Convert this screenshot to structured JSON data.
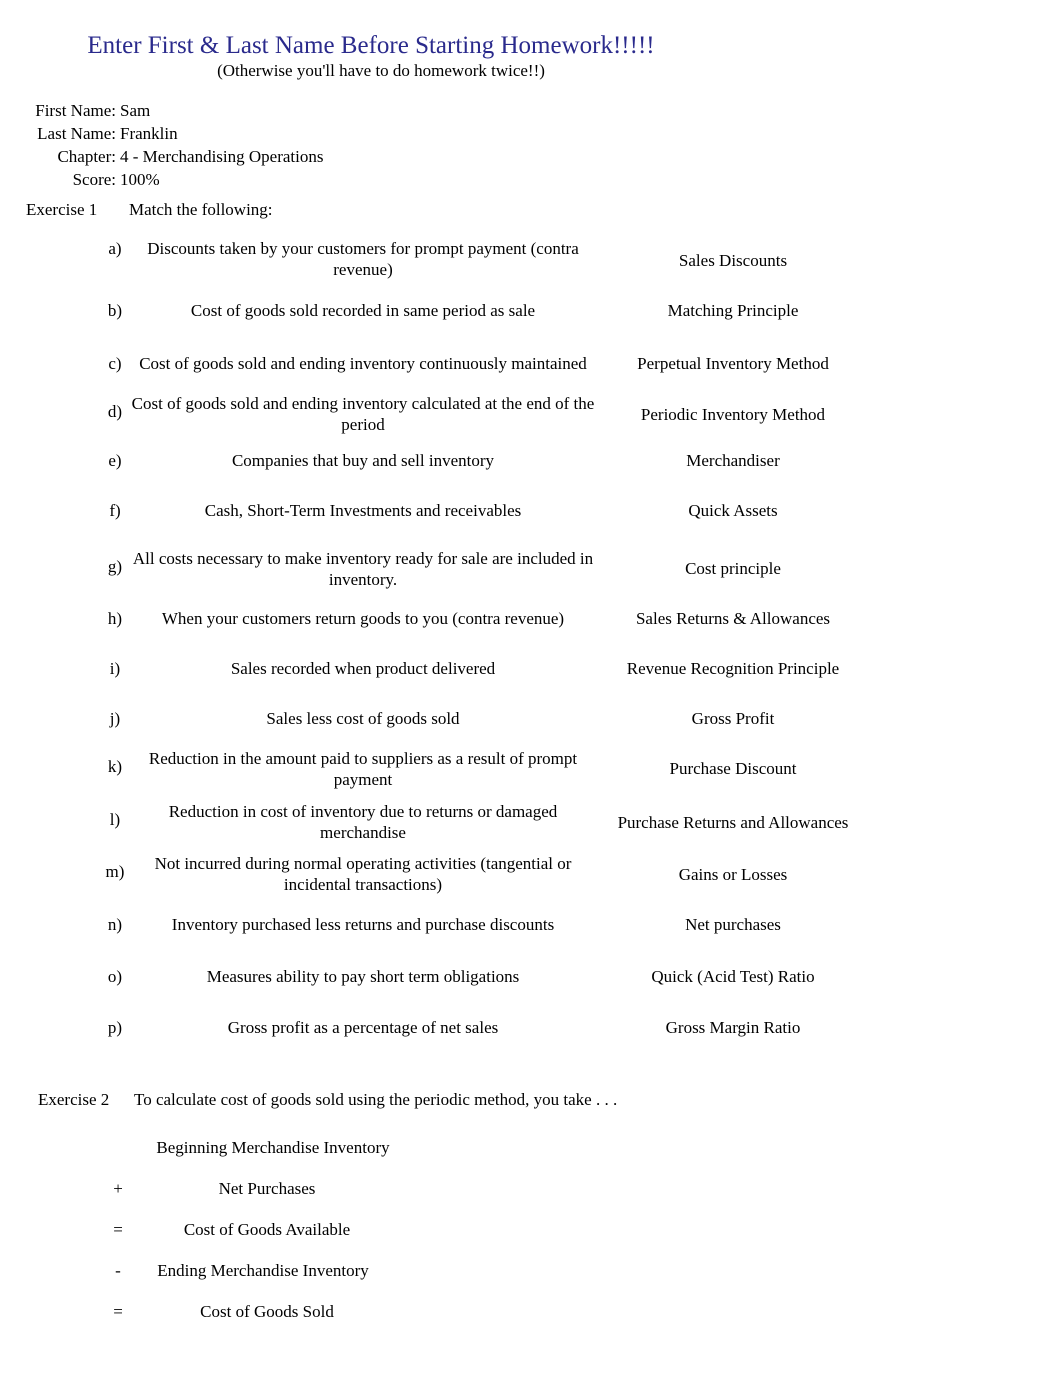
{
  "header": {
    "title": "Enter First & Last Name Before Starting Homework!!!!!",
    "subtitle": "(Otherwise you'll have to do homework twice!!)",
    "title_color": "#2a2a8c"
  },
  "info": {
    "fields": [
      {
        "label": "First Name:",
        "value": "Sam"
      },
      {
        "label": "Last Name:",
        "value": "Franklin"
      },
      {
        "label": "Chapter:",
        "value": "4 - Merchandising Operations"
      },
      {
        "label": "Score:",
        "value": "100%"
      }
    ]
  },
  "exercise1": {
    "number": "Exercise 1",
    "instruction": "Match the following:",
    "rows": [
      {
        "letter": "a)",
        "description": "Discounts taken by your customers for prompt payment (contra revenue)",
        "term": "Sales Discounts"
      },
      {
        "letter": "b)",
        "description": "Cost of goods sold recorded in same period as sale",
        "term": "Matching Principle"
      },
      {
        "letter": "c)",
        "description": "Cost of goods sold and ending inventory continuously maintained",
        "term": "Perpetual Inventory Method"
      },
      {
        "letter": "d)",
        "description": "Cost of goods sold and ending inventory calculated at the end of the period",
        "term": "Periodic Inventory Method"
      },
      {
        "letter": "e)",
        "description": "Companies that buy and sell inventory",
        "term": "Merchandiser"
      },
      {
        "letter": "f)",
        "description": "Cash, Short-Term Investments and receivables",
        "term": "Quick Assets"
      },
      {
        "letter": "g)",
        "description": "All costs necessary to make inventory ready for sale are included in inventory.",
        "term": "Cost principle"
      },
      {
        "letter": "h)",
        "description": "When your customers return goods to you (contra revenue)",
        "term": "Sales Returns & Allowances"
      },
      {
        "letter": "i)",
        "description": "Sales recorded when product delivered",
        "term": "Revenue Recognition Principle"
      },
      {
        "letter": "j)",
        "description": "Sales less cost of goods sold",
        "term": "Gross Profit"
      },
      {
        "letter": "k)",
        "description": "Reduction in the amount paid to suppliers as a result of prompt payment",
        "term": "Purchase Discount"
      },
      {
        "letter": "l)",
        "description": "Reduction in cost of inventory due to returns or damaged merchandise",
        "term": "Purchase Returns and Allowances"
      },
      {
        "letter": "m)",
        "description": "Not incurred during normal operating activities (tangential or incidental transactions)",
        "term": "Gains or Losses"
      },
      {
        "letter": "n)",
        "description": "Inventory purchased less returns and purchase discounts",
        "term": "Net purchases"
      },
      {
        "letter": "o)",
        "description": "Measures ability to pay short term obligations",
        "term": "Quick (Acid Test) Ratio"
      },
      {
        "letter": "p)",
        "description": "Gross profit as a percentage of net sales",
        "term": "Gross Margin Ratio"
      }
    ]
  },
  "exercise2": {
    "number": "Exercise 2",
    "instruction": "To calculate cost of goods sold using the periodic method, you take . . .",
    "lines": [
      {
        "operator": "",
        "term": "Beginning Merchandise Inventory"
      },
      {
        "operator": "+",
        "term": "Net Purchases"
      },
      {
        "operator": "=",
        "term": "Cost of Goods Available"
      },
      {
        "operator": "-",
        "term": "Ending Merchandise Inventory"
      },
      {
        "operator": "=",
        "term": "Cost of Goods Sold"
      }
    ]
  }
}
